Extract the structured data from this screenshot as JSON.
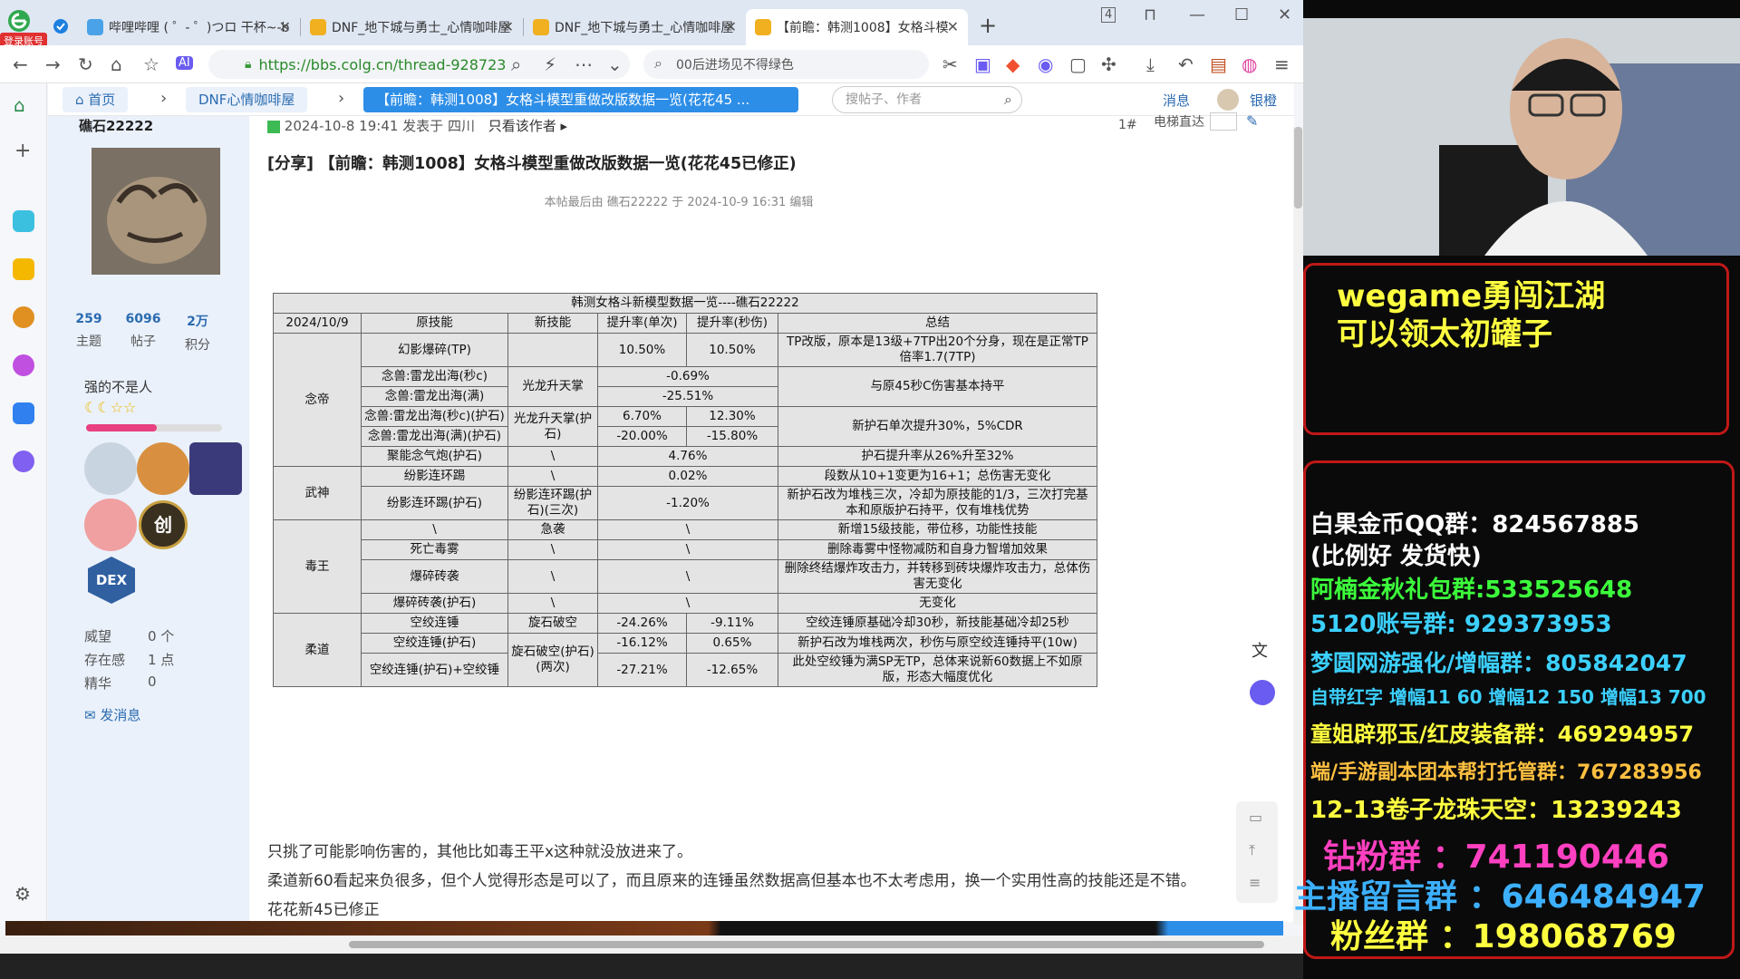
{
  "browser": {
    "login_badge": "登录账号",
    "tabs": [
      {
        "label": "哔哩哔哩 ( ゜- ゜)つロ 干杯~-b"
      },
      {
        "label": "DNF_地下城与勇士_心情咖啡屋"
      },
      {
        "label": "DNF_地下城与勇士_心情咖啡屋"
      },
      {
        "label": "【前瞻：韩测1008】女格斗模"
      }
    ],
    "new_tab": "+",
    "tab_count": "4",
    "url": "https://bbs.colg.cn/thread-928723",
    "search_text": "00后进场见不得绿色"
  },
  "breadcrumb": {
    "home": "首页",
    "forum": "DNF心情咖啡屋",
    "current": "【前瞻：韩测1008】女格斗模型重做改版数据一览(花花45 ...",
    "search_placeholder": "搜帖子、作者",
    "messages": "消息",
    "user": "银橙"
  },
  "user": {
    "name": "礁石22222",
    "stats": [
      {
        "value": "259",
        "label": "主题"
      },
      {
        "value": "6096",
        "label": "帖子"
      },
      {
        "value": "2万",
        "label": "积分"
      }
    ],
    "title": "强的不是人",
    "rep_label": "威望",
    "rep_value": "0 个",
    "presence_label": "存在感",
    "presence_value": "1 点",
    "essence_label": "精华",
    "essence_value": "0",
    "send_msg": "发消息"
  },
  "post": {
    "meta": "2024-10-8 19:41 发表于 四川",
    "only_author": "只看该作者",
    "floor": "1#",
    "elevator": "电梯直达",
    "title": "[分享] 【前瞻：韩测1008】女格斗模型重做改版数据一览(花花45已修正)",
    "edited": "本帖最后由 礁石22222 于 2024-10-9 16:31 编辑",
    "para1": "只挑了可能影响伤害的，其他比如毒王平x这种就没放进来了。",
    "para2": "柔道新60看起来负很多，但个人觉得形态是可以了，而且原来的连锤虽然数据高但基本也不太考虑用，换一个实用性高的技能还是不错。",
    "para3": "花花新45已修正"
  },
  "table": {
    "title": "韩测女格斗新模型数据一览----礁石22222",
    "headers": [
      "2024/10/9",
      "原技能",
      "新技能",
      "提升率(单次)",
      "提升率(秒伤)",
      "总结"
    ],
    "nian": "念帝",
    "wushen": "武神",
    "duwang": "毒王",
    "roudao": "柔道",
    "r1": [
      "幻影爆碎(TP)",
      "",
      "10.50%",
      "10.50%",
      "TP改版，原本是13级+7TP出20个分身，现在是正常TP倍率1.7(7TP)"
    ],
    "r2": [
      "念兽:雷龙出海(秒c)",
      "光龙升天掌",
      "-0.69%",
      "与原45秒C伤害基本持平"
    ],
    "r3": [
      "念兽:雷龙出海(满)",
      "-25.51%"
    ],
    "r4": [
      "念兽:雷龙出海(秒c)(护石)",
      "光龙升天掌(护石)",
      "6.70%",
      "12.30%",
      "新护石单次提升30%，5%CDR"
    ],
    "r5": [
      "念兽:雷龙出海(满)(护石)",
      "-20.00%",
      "-15.80%"
    ],
    "r6": [
      "聚能念气炮(护石)",
      "\\",
      "4.76%",
      "护石提升率从26%升至32%"
    ],
    "r7": [
      "纷影连环踢",
      "\\",
      "0.02%",
      "段数从10+1变更为16+1；总伤害无变化"
    ],
    "r8": [
      "纷影连环踢(护石)",
      "纷影连环踢(护石)(三次)",
      "-1.20%",
      "新护石改为堆栈三次，冷却为原技能的1/3，三次打完基本和原版护石持平，仅有堆栈优势"
    ],
    "r9": [
      "\\",
      "急袭",
      "\\",
      "新增15级技能，带位移，功能性技能"
    ],
    "r10": [
      "死亡毒雾",
      "\\",
      "\\",
      "删除毒雾中怪物减防和自身力智增加效果"
    ],
    "r11": [
      "爆碎砖袭",
      "\\",
      "\\",
      "删除终结爆炸攻击力，并转移到砖块爆炸攻击力，总体伤害无变化"
    ],
    "r12": [
      "爆碎砖袭(护石)",
      "\\",
      "\\",
      "无变化"
    ],
    "r13": [
      "空绞连锤",
      "旋石破空",
      "-24.26%",
      "-9.11%",
      "空绞连锤原基础冷却30秒，新技能基础冷却25秒"
    ],
    "r14": [
      "空绞连锤(护石)",
      "旋石破空(护石)(两次)",
      "-16.12%",
      "0.65%",
      "新护石改为堆栈两次，秒伤与原空绞连锤持平(10w)"
    ],
    "r15": [
      "空绞连锤(护石)+空绞锤",
      "-27.21%",
      "-12.65%",
      "此处空绞锤为满SP无TP，总体来说新60数据上不如原版，形态大幅度优化"
    ]
  },
  "overlay": {
    "promo1": "wegame勇闯江湖",
    "promo2": "可以领太初罐子",
    "lines": [
      {
        "text": "白果金币QQ群：824567885",
        "color": "#ffffff"
      },
      {
        "text": "(比例好 发货快)",
        "color": "#ffffff"
      },
      {
        "text": "阿楠金秋礼包群:533525648",
        "color": "#3cff3c"
      },
      {
        "text": "5120账号群: 929373953",
        "color": "#3cd0ff"
      },
      {
        "text": "梦圆网游强化/增幅群：805842047",
        "color": "#3cd0ff"
      },
      {
        "text": "自带红字 增幅11 60 增幅12 150 增幅13 700",
        "color": "#3cd0ff"
      },
      {
        "text": "童姐辟邪玉/红皮装备群：469294957",
        "color": "#ffff40"
      },
      {
        "text": "端/手游副本团本帮打托管群：767283956",
        "color": "#ffc040"
      },
      {
        "text": "12-13卷子龙珠天空：13239243",
        "color": "#ffff40"
      },
      {
        "text": "钻粉群 ：741190446",
        "color": "#ff40c0"
      },
      {
        "text": "主播留言群 ：646484947",
        "color": "#3cb0ff"
      },
      {
        "text": "粉丝群 ：198068769",
        "color": "#ffff40"
      }
    ]
  }
}
